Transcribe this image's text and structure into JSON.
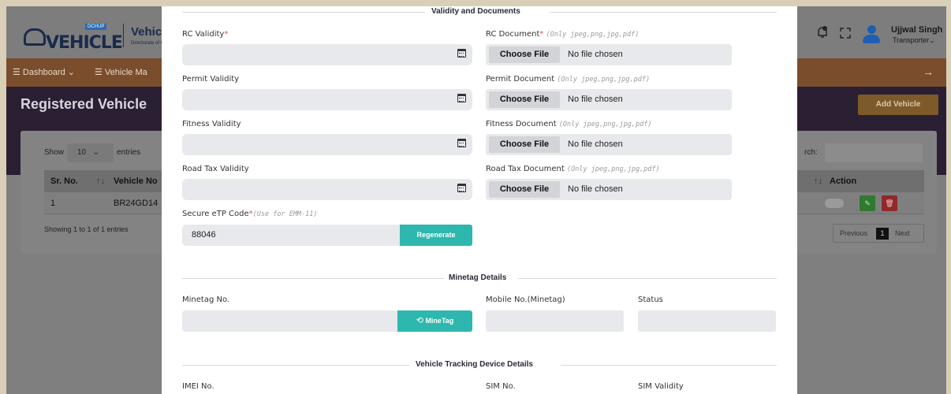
{
  "app": {
    "logo_text": "VEHICLE",
    "logo_badge": "DCHUP",
    "brand_title": "Vehicle R",
    "brand_subtitle": "Directorate of Ge"
  },
  "user": {
    "name": "Ujjwal Singh",
    "role": "Transporter⌄"
  },
  "nav": {
    "items": [
      {
        "label": "☰ Dashboard ⌄"
      },
      {
        "label": "☰ Vehicle Ma"
      }
    ],
    "arrow": "→"
  },
  "page": {
    "title": "Registered Vehicle",
    "add_button": "Add Vehicle"
  },
  "table": {
    "show_label": "Show",
    "show_value": "10",
    "entries_label": "entries",
    "search_label": "rch:",
    "headers": [
      "Sr. No.",
      "Vehicle No",
      "Action"
    ],
    "rows": [
      {
        "sr": "1",
        "vehicle": "BR24GD14"
      }
    ],
    "info": "Showing 1 to 1 of 1 entries",
    "pagination": {
      "prev": "Previous",
      "current": "1",
      "next": "Next"
    }
  },
  "modal": {
    "validity_section": "Validity and Documents",
    "rc_validity_label": "RC Validity",
    "rc_document_label": "RC Document",
    "permit_validity_label": "Permit Validity",
    "permit_document_label": "Permit Document",
    "fitness_validity_label": "Fitness Validity",
    "fitness_document_label": "Fitness Document",
    "roadtax_validity_label": "Road Tax Validity",
    "roadtax_document_label": "Road Tax Document",
    "file_hint": "(Only jpeg,png,jpg,pdf)",
    "choose_file": "Choose File",
    "no_file": "No file chosen",
    "etp_label": "Secure eTP Code",
    "etp_hint": "(Use for EMM-11)",
    "etp_value": "88046",
    "regenerate": "Regenerate",
    "minetag_section": "Minetag Details",
    "minetag_no_label": "Minetag No.",
    "minetag_button": "MineTag",
    "mobile_label": "Mobile No.(Minetag)",
    "status_label": "Status",
    "tracking_section": "Vehicle Tracking Device Details",
    "imei_label": "IMEI No.",
    "sim_label": "SIM No.",
    "sim_validity_label": "SIM Validity"
  },
  "colors": {
    "accent_teal": "#2db7ae",
    "required_red": "#d9534f"
  },
  "icons": [
    "calendar-icon",
    "refresh-icon",
    "bell-icon",
    "expand-icon",
    "user-icon"
  ]
}
